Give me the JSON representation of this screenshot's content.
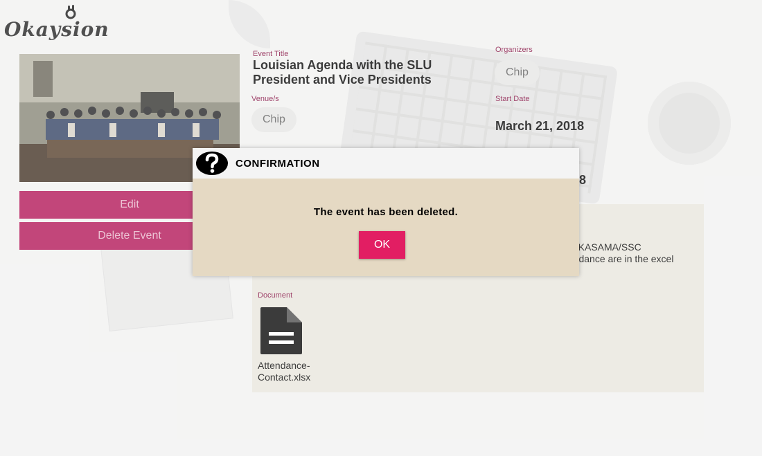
{
  "app": {
    "logo_text": "Okaysion",
    "logo_icon": "ok-hand-icon"
  },
  "actions": {
    "edit_label": "Edit",
    "delete_label": "Delete Event"
  },
  "event": {
    "title_label": "Event Title",
    "title": "Louisian Agenda with the SLU President and Vice Presidents",
    "organizers_label": "Organizers",
    "organizer_chip": "Chip",
    "venues_label": "Venue/s",
    "venue_chip": "Chip",
    "start_date_label": "Start Date",
    "start_date": "March 21, 2018",
    "end_date_partial": "8",
    "description_partial_1": "ts, KASAMA/SSC",
    "description_partial_2": "tendance are in the excel",
    "document_label": "Document",
    "document_name": "Attendance-Contact.xlsx",
    "document_icon": "file-icon"
  },
  "dialog": {
    "icon": "question-icon",
    "title": "CONFIRMATION",
    "message": "The event has been deleted.",
    "ok_label": "OK"
  },
  "colors": {
    "accent": "#b51e5d",
    "ok_button": "#e21e63",
    "label": "#8a1a4a",
    "dialog_body": "#e5d9c3",
    "panel": "#e9e7de"
  }
}
